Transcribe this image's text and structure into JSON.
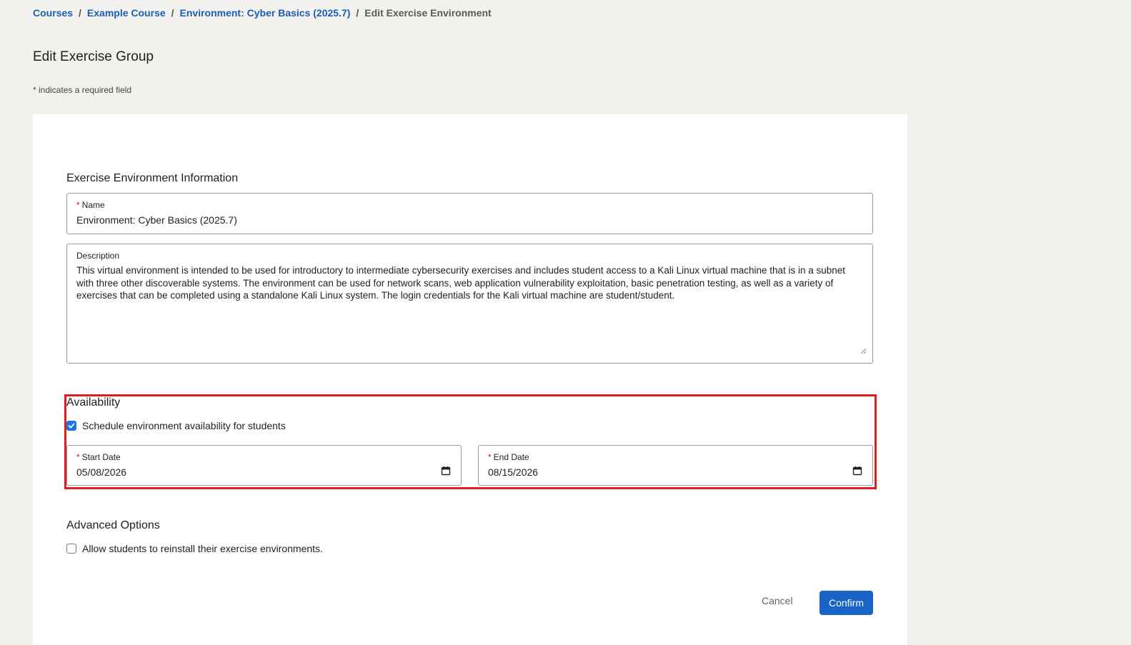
{
  "breadcrumb": {
    "items": [
      "Courses",
      "Example Course",
      "Environment: Cyber Basics (2025.7)"
    ],
    "separator": "/",
    "current": "Edit Exercise Environment"
  },
  "page": {
    "title": "Edit Exercise Group",
    "required_note": "* indicates a required field"
  },
  "info_section": {
    "title": "Exercise Environment Information",
    "name_label": "Name",
    "name_value": "Environment: Cyber Basics (2025.7)",
    "description_label": "Description",
    "description_value": "This virtual environment is intended to be used for introductory to intermediate cybersecurity exercises and includes student access to a Kali Linux virtual machine that is in a subnet with three other discoverable systems. The environment can be used for network scans, web application vulnerability exploitation, basic penetration testing, as well as a variety of exercises that can be completed using a standalone Kali Linux system. The login credentials for the Kali virtual machine are student/student."
  },
  "availability": {
    "title": "Availability",
    "schedule_label": "Schedule environment availability for students",
    "schedule_checked": true,
    "start_label": "Start Date",
    "start_value": "05/08/2026",
    "end_label": "End Date",
    "end_value": "08/15/2026"
  },
  "advanced": {
    "title": "Advanced Options",
    "reinstall_label": "Allow students to reinstall their exercise environments.",
    "reinstall_checked": false
  },
  "actions": {
    "cancel_label": "Cancel",
    "confirm_label": "Confirm"
  },
  "colors": {
    "link": "#1a5fb4",
    "primary": "#1a64c8",
    "required": "#c41e1e",
    "highlight": "#e21c1c",
    "background": "#f2f1ee"
  }
}
